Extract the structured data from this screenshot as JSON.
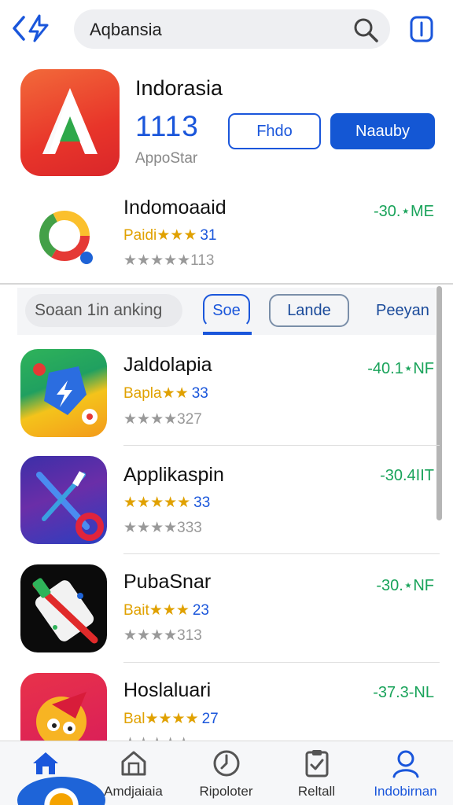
{
  "search": {
    "value": "Aqbansia"
  },
  "featured": {
    "title": "Indorasia",
    "rating": "1113",
    "store": "AppoStar",
    "button_outline": "Fhdo",
    "button_primary": "Naauby"
  },
  "apps": [
    {
      "title": "Indomoaaid",
      "sub_label": "Paidi",
      "sub_num": "31",
      "stars_text": "★★★★★113",
      "size": "-30.⋆ME"
    },
    {
      "title": "Jaldolapia",
      "sub_label": "Baplа",
      "sub_num": "33",
      "stars_text": "★★★★327",
      "size": "-40.1⋆NF"
    },
    {
      "title": "Applikaspin",
      "sub_label": "",
      "sub_num": "33",
      "stars_text": "★★★★333",
      "size": "-30.4IIT"
    },
    {
      "title": "PubaSnar",
      "sub_label": "Bait",
      "sub_num": "23",
      "stars_text": "★★★★313",
      "size": "-30.⋆NF"
    },
    {
      "title": "Hoslaluari",
      "sub_label": "Bal",
      "sub_num": "27",
      "stars_text": "★★★★★",
      "size": "-37.3-NL"
    }
  ],
  "filters": {
    "search_chip": "Soaan 1in anking",
    "active": "Soe",
    "outline": "Lande",
    "plain": "Peeyan"
  },
  "nav": [
    {
      "label": "Amdjaiaia"
    },
    {
      "label": "Ripoloter"
    },
    {
      "label": "Reltall"
    },
    {
      "label": "Indobirnan"
    }
  ],
  "colors": {
    "accent": "#1a56db",
    "star": "#e0a100",
    "size_green": "#19a35a"
  },
  "icons": {
    "back": "back-share-icon",
    "search": "search-icon",
    "menu": "menu-icon",
    "nav": [
      "home-icon",
      "store-icon",
      "history-icon",
      "clipboard-icon",
      "profile-icon"
    ]
  }
}
